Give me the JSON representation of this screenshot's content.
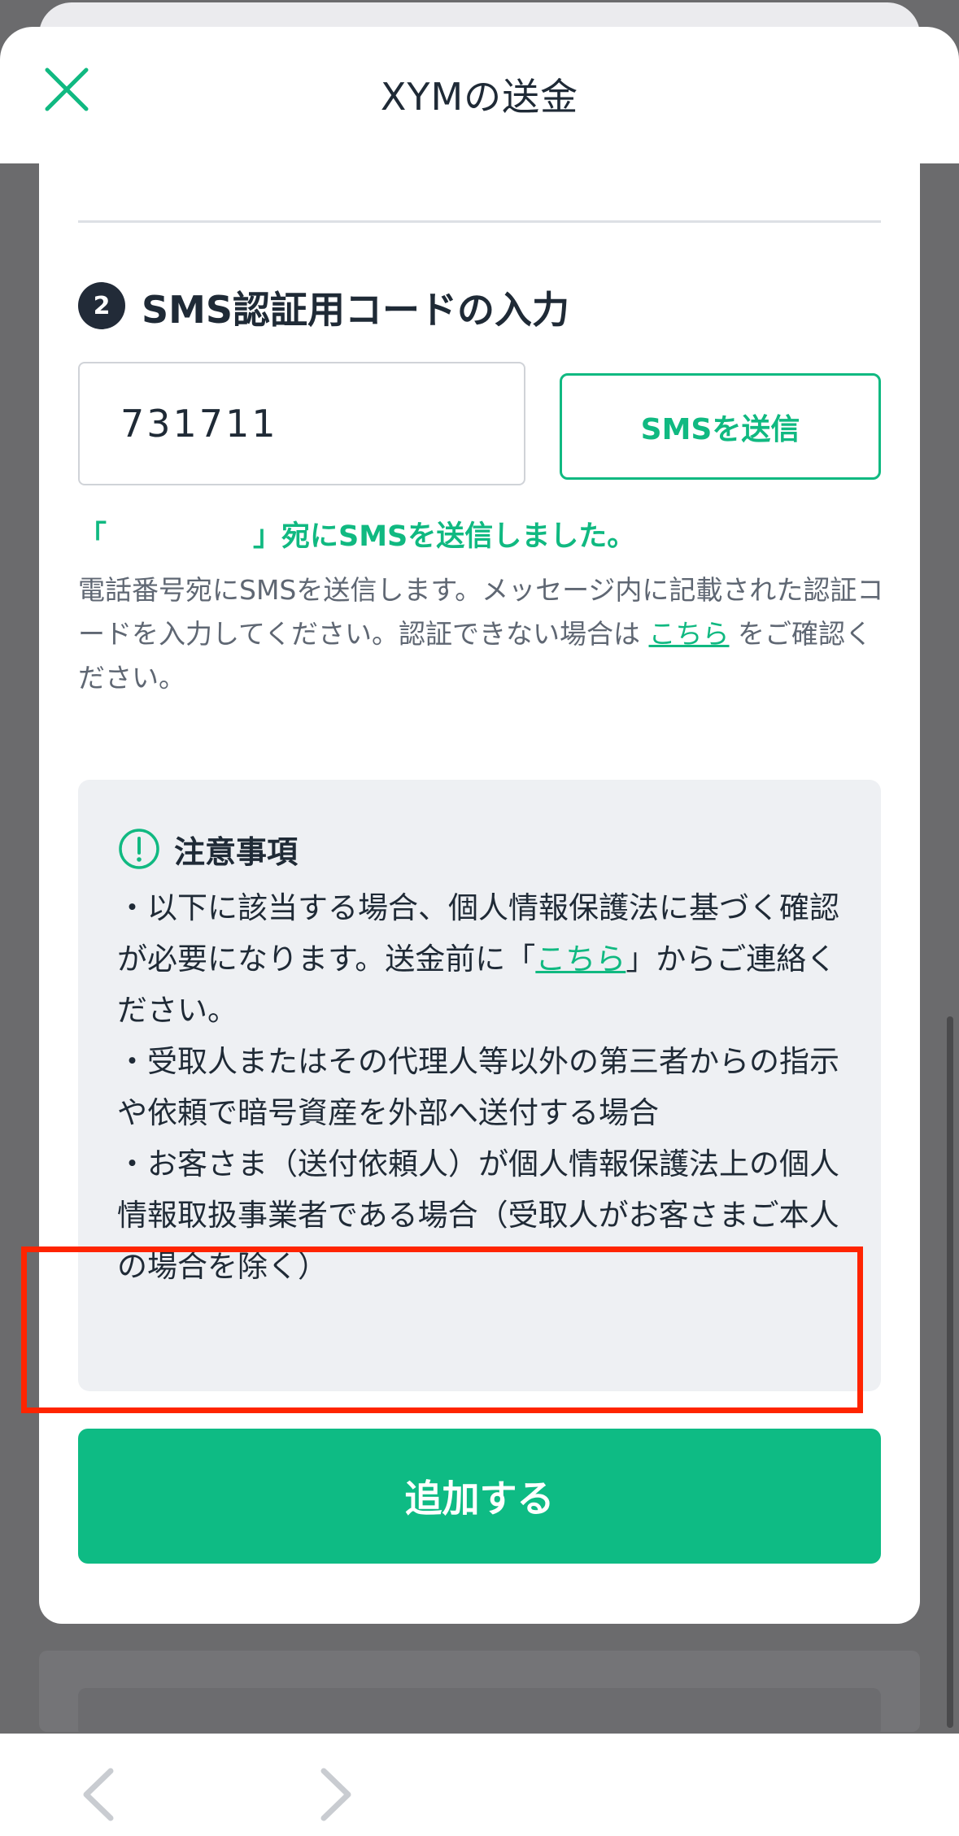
{
  "header": {
    "title": "XYMの送金"
  },
  "step": {
    "number": "2",
    "title": "SMS認証用コードの入力"
  },
  "code_input": {
    "value": "731711"
  },
  "sms_button": {
    "label": "SMSを送信"
  },
  "sent_message": {
    "open_bracket": "「",
    "close_suffix": "」宛にSMSを送信しました。"
  },
  "help": {
    "text_before_link": "電話番号宛にSMSを送信します。メッセージ内に記載された認証コードを入力してください。認証できない場合は ",
    "link": "こちら",
    "text_after_link": " をご確認ください。"
  },
  "notice": {
    "title": "注意事項",
    "para1_before_link": "・以下に該当する場合、個人情報保護法に基づく確認が必要になります。送金前に「",
    "para1_link": "こちら",
    "para1_after_link": "」からご連絡ください。",
    "para2": "・受取人またはその代理人等以外の第三者からの指示や依頼で暗号資産を外部へ送付する場合",
    "para3": "・お客さま（送付依頼人）が個人情報保護法上の個人情報取扱事業者である場合（受取人がお客さまご本人の場合を除く）"
  },
  "add_button": {
    "label": "追加する"
  },
  "colors": {
    "accent": "#10b981",
    "primary_button": "#0ebb84",
    "highlight_border": "#ff2400",
    "text_dark": "#1f2a36"
  }
}
